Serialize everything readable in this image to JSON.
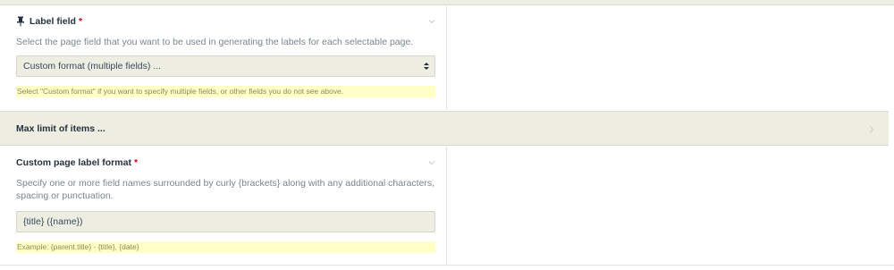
{
  "label_field": {
    "title": "Label field",
    "required_mark": "*",
    "description": "Select the page field that you want to be used in generating the labels for each selectable page.",
    "selected_option": "Custom format (multiple fields) ...",
    "notes": "Select \"Custom format\" if you want to specify multiple fields, or other fields you do not see above."
  },
  "max_limit": {
    "title": "Max limit of items ..."
  },
  "custom_format": {
    "title": "Custom page label format",
    "required_mark": "*",
    "description_line1": "Specify one or more field names surrounded by curly {brackets} along with any additional characters,",
    "description_line2": "spacing or punctuation.",
    "value": "{title} ({name})",
    "notes": "Example: {parent.title} - {title}, {date}"
  },
  "icons": {
    "pin": "pin-icon",
    "collapse": "chevron-down-icon",
    "expand": "chevron-right-icon",
    "select": "select-arrows-icon"
  },
  "colors": {
    "panel": "#eeede1",
    "notes_bg": "#ffffc6",
    "required": "#e0001a"
  }
}
